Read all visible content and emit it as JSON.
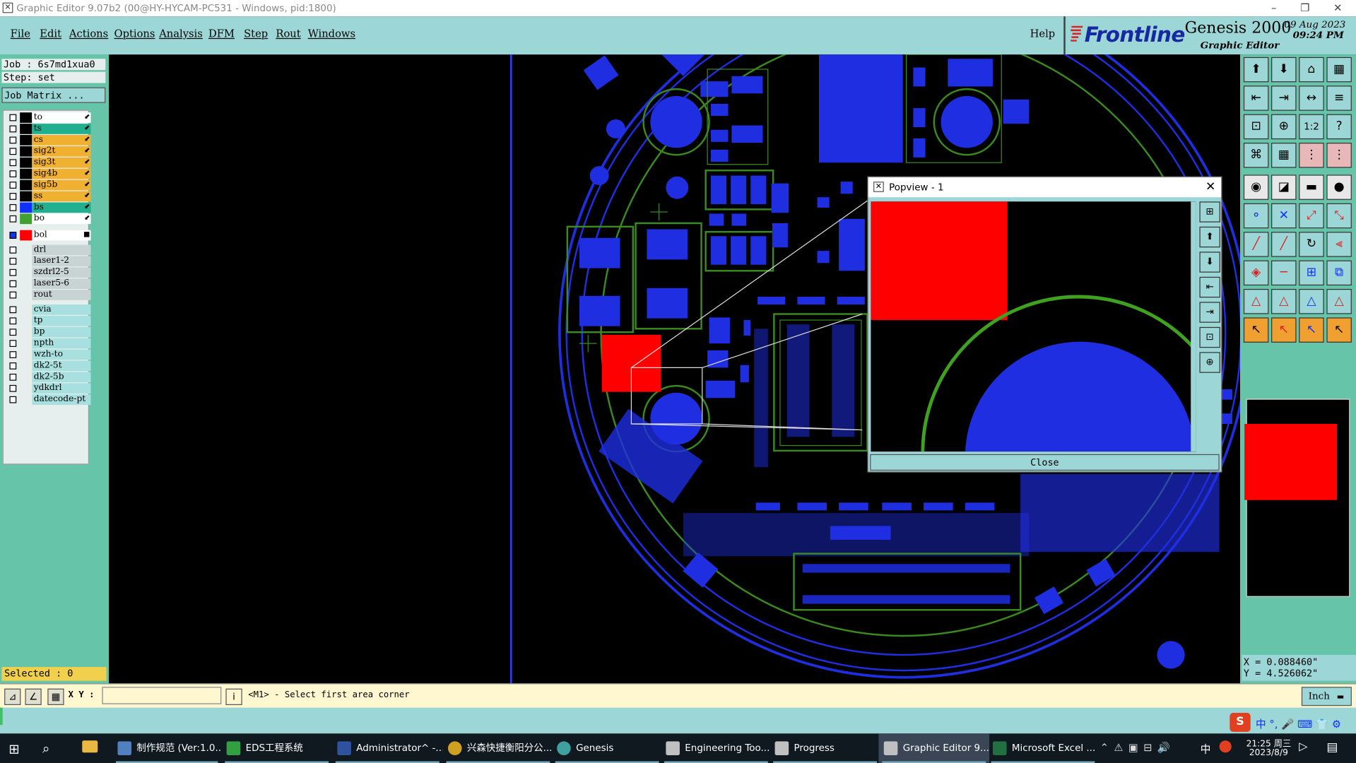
{
  "window": {
    "title": "Graphic Editor 9.07b2 (00@HY-HYCAM-PC531 - Windows, pid:1800)",
    "min_glyph": "–",
    "max_glyph": "❐",
    "close_glyph": "✕"
  },
  "menu": {
    "items": [
      "File",
      "Edit",
      "Actions",
      "Options",
      "Analysis",
      "DFM",
      "Step",
      "Rout",
      "Windows"
    ],
    "help": "Help"
  },
  "logo": {
    "brand": "Frontline",
    "product": "Genesis 2000",
    "subtitle": "Graphic Editor",
    "date": "09 Aug 2023",
    "time": "09:24 PM"
  },
  "job": {
    "job_label": "Job : 6s7md1xua0",
    "step_label": "Step: set",
    "matrix_button": "Job Matrix ..."
  },
  "layers": {
    "board": [
      {
        "name": "to",
        "bg": "#ffffff",
        "swatch": "#000000"
      },
      {
        "name": "ts",
        "bg": "#20b090",
        "swatch": "#000000"
      },
      {
        "name": "cs",
        "bg": "#f0b030",
        "swatch": "#000000"
      },
      {
        "name": "sig2t",
        "bg": "#f0b030",
        "swatch": "#000000"
      },
      {
        "name": "sig3t",
        "bg": "#f0b030",
        "swatch": "#000000"
      },
      {
        "name": "sig4b",
        "bg": "#f0b030",
        "swatch": "#000000"
      },
      {
        "name": "sig5b",
        "bg": "#f0b030",
        "swatch": "#000000"
      },
      {
        "name": "ss",
        "bg": "#f0b030",
        "swatch": "#000000"
      },
      {
        "name": "bs",
        "bg": "#20b090",
        "swatch": "#1030ff"
      },
      {
        "name": "bo",
        "bg": "#ffffff",
        "swatch": "#40a030"
      }
    ],
    "selected": {
      "name": "bol",
      "bg": "#ffffff",
      "swatch": "#ff0000"
    },
    "drill": [
      "drl",
      "laser1-2",
      "szdrl2-5",
      "laser5-6",
      "rout"
    ],
    "misc": [
      "cvia",
      "tp",
      "bp",
      "npth",
      "wzh-to",
      "dk2-5t",
      "dk2-5b",
      "ydkdrl",
      "datecode-pt"
    ]
  },
  "selected_count": "Selected : 0",
  "right_toolbar": {
    "rows": [
      [
        "⬆",
        "⬇",
        "⌂",
        "▦"
      ],
      [
        "⇤",
        "⇥",
        "↔",
        "≡"
      ],
      [
        "⊡",
        "⊕",
        "1:2",
        "?"
      ],
      [
        "⌘",
        "▦",
        "⋮",
        "⋮"
      ],
      [
        "◉",
        "◪",
        "▬",
        "●"
      ],
      [
        "⚬",
        "✕",
        "⤢",
        "⤡"
      ],
      [
        "╱",
        "╱",
        "↻",
        "⫷"
      ],
      [
        "◈",
        "─",
        "⊞",
        "⧉"
      ],
      [
        "△",
        "△",
        "△",
        "△"
      ],
      [
        "↖",
        "↖",
        "↖",
        "↖"
      ]
    ]
  },
  "coords": {
    "x": "X = 0.088460\"",
    "y": "Y = 4.526062\""
  },
  "bottom": {
    "xy_label": "X Y :",
    "xy_value": "",
    "prompt": "<M1> - Select first area corner",
    "unit": "Inch"
  },
  "popview": {
    "title": "Popview - 1",
    "close_label": "Close"
  },
  "taskbar": {
    "items": [
      {
        "label": "制作规范 (Ver:1.0...",
        "color": "#5080c0"
      },
      {
        "label": "EDS工程系统",
        "color": "#30a040"
      },
      {
        "label": "Administrator^ -...",
        "color": "#3050a0"
      },
      {
        "label": "兴森快捷衡阳分公...",
        "color": "#d0a020"
      },
      {
        "label": "Genesis",
        "color": "#40a0a0"
      },
      {
        "label": "Engineering Too...",
        "color": "#c0c0c0"
      },
      {
        "label": "Progress",
        "color": "#c0c0c0"
      },
      {
        "label": "Graphic Editor 9...",
        "color": "#c0c0c0"
      },
      {
        "label": "Microsoft Excel ...",
        "color": "#207040"
      }
    ],
    "ime": "中",
    "clock_time": "21:25 周三",
    "clock_date": "2023/8/9"
  }
}
